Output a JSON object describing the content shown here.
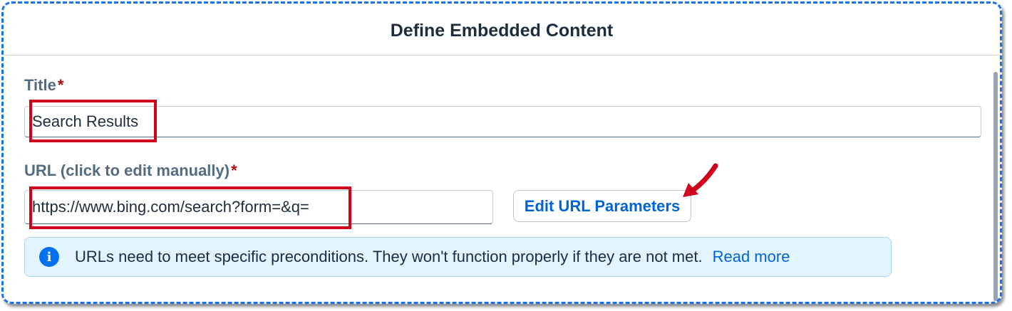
{
  "dialog": {
    "title": "Define Embedded Content"
  },
  "form": {
    "title_label": "Title",
    "title_required_mark": "*",
    "title_value": "Search Results",
    "url_label": "URL (click to edit manually)",
    "url_required_mark": "*",
    "url_value": "https://www.bing.com/search?form=&q=",
    "edit_params_label": "Edit URL Parameters"
  },
  "info": {
    "icon": "info-icon",
    "message": "URLs need to meet specific preconditions. They won't function properly if they are not met.",
    "link_label": "Read more"
  },
  "colors": {
    "highlight": "#d0021b",
    "accent": "#0064d9",
    "info_bg": "#e1f4ff",
    "frame": "#1a73e8"
  }
}
